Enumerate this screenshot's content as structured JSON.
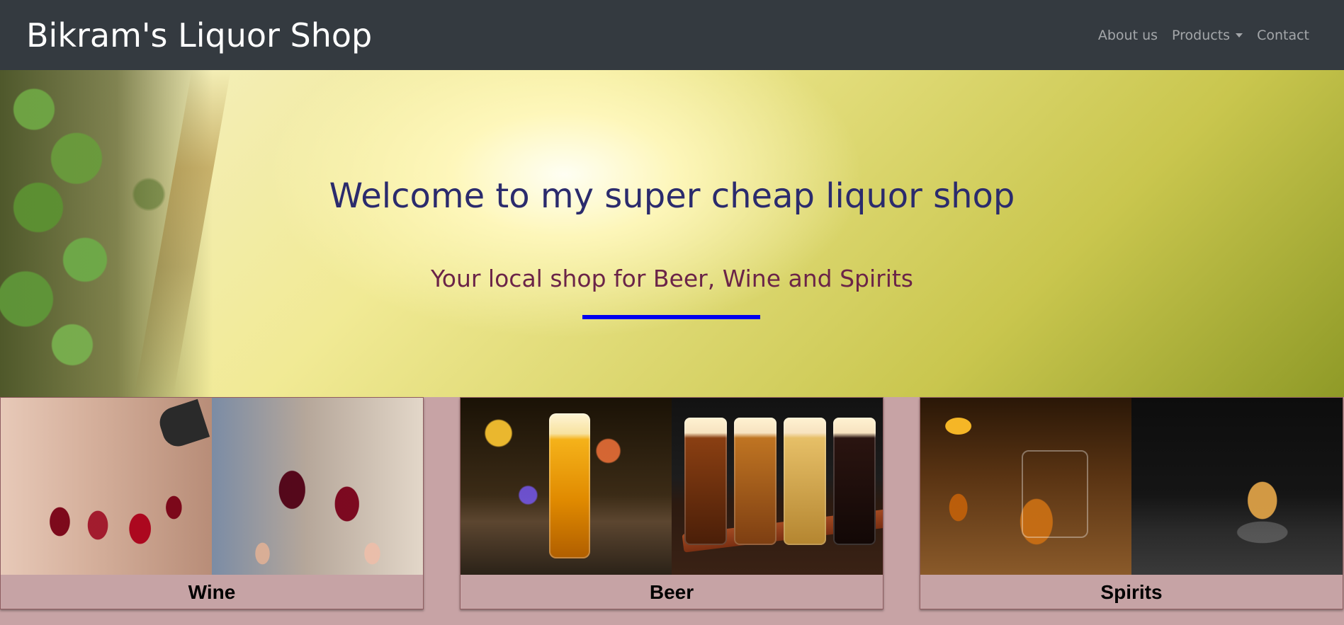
{
  "navbar": {
    "brand": "Bikram's Liquor Shop",
    "links": {
      "about": "About us",
      "products": "Products",
      "contact": "Contact"
    }
  },
  "hero": {
    "title": "Welcome to my super cheap liquor shop",
    "subtitle": "Your local shop for Beer, Wine and Spirits",
    "accent_color": "#0000ee"
  },
  "categories": [
    {
      "label": "Wine"
    },
    {
      "label": "Beer"
    },
    {
      "label": "Spirits"
    }
  ],
  "colors": {
    "navbar": "#343a40",
    "page_background": "#c7a3a5",
    "title_text": "#2b2b6d",
    "subtitle_text": "#6b2448"
  }
}
